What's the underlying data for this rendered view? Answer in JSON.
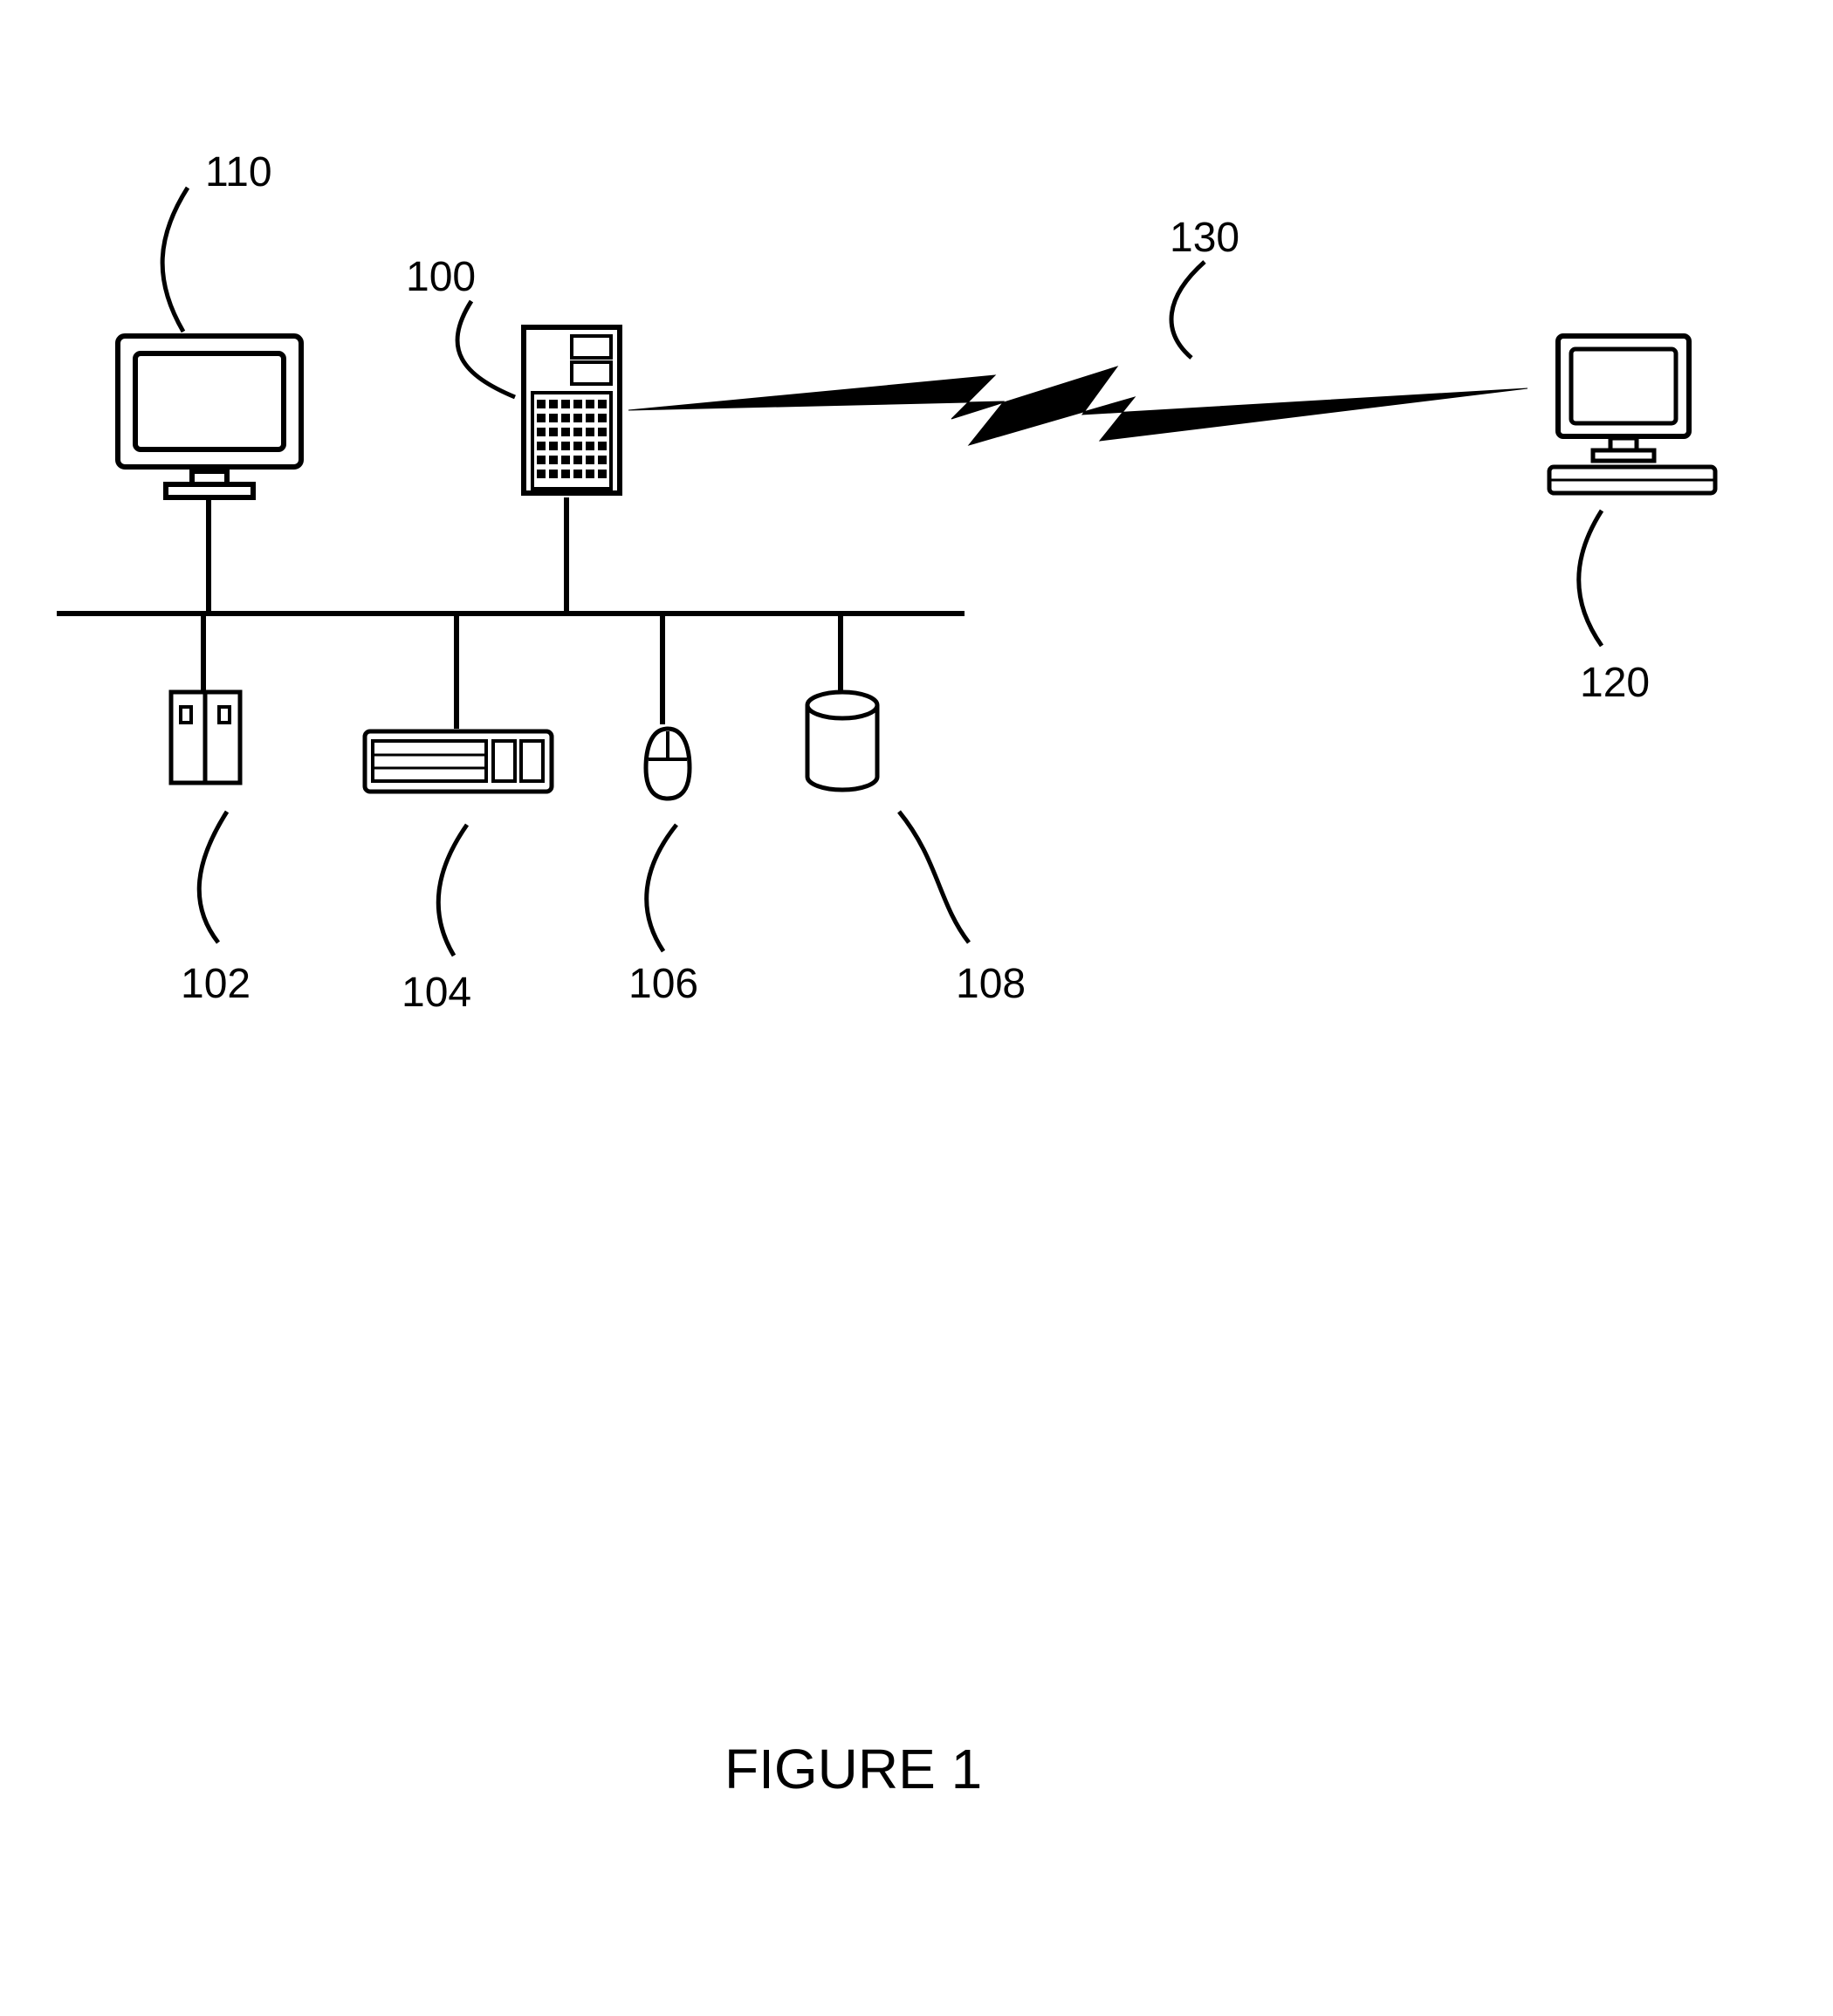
{
  "labels": {
    "server": "100",
    "cpu": "102",
    "keyboard": "104",
    "mouse": "106",
    "storage": "108",
    "monitor": "110",
    "remote_pc": "120",
    "wireless": "130"
  },
  "caption": "FIGURE 1"
}
